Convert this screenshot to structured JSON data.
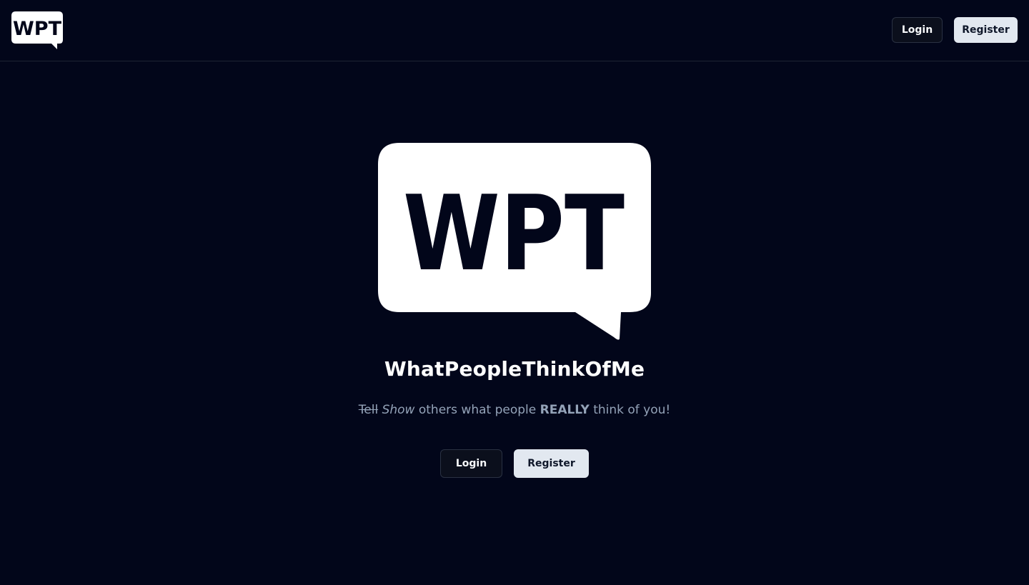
{
  "header": {
    "logo_text": "WPT",
    "logo_icon": "speech-bubble-logo",
    "login_label": "Login",
    "register_label": "Register"
  },
  "hero": {
    "logo_text": "WPT",
    "site_name": "WhatPeopleThinkOfMe",
    "tagline": {
      "struck": "Tell",
      "italic": "Show",
      "middle": "others what people",
      "emphasis": "REALLY",
      "end": "think of you!"
    },
    "login_label": "Login",
    "register_label": "Register"
  },
  "colors": {
    "background": "#02061a",
    "logo_bubble": "#ffffff",
    "logo_text": "#02061a",
    "muted_text": "#94a3b8",
    "button_solid": "#e2e8f0",
    "button_outline": "#0b0f1c"
  }
}
